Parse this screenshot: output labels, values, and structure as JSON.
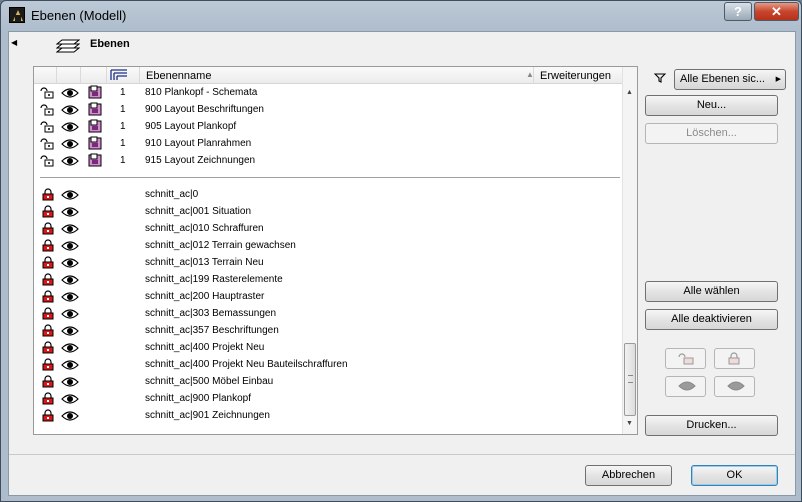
{
  "window": {
    "title": "Ebenen (Modell)",
    "help": "?",
    "close": "✕"
  },
  "header": {
    "title": "Ebenen"
  },
  "list": {
    "columns": {
      "name": "Ebenenname",
      "extensions": "Erweiterungen"
    },
    "group1": [
      {
        "num": "1",
        "name": "810 Plankopf - Schemata"
      },
      {
        "num": "1",
        "name": "900 Layout Beschriftungen"
      },
      {
        "num": "1",
        "name": "905 Layout Plankopf"
      },
      {
        "num": "1",
        "name": "910 Layout Planrahmen"
      },
      {
        "num": "1",
        "name": "915 Layout Zeichnungen"
      }
    ],
    "group2": [
      {
        "name": "schnitt_ac|0"
      },
      {
        "name": "schnitt_ac|001 Situation"
      },
      {
        "name": "schnitt_ac|010 Schraffuren"
      },
      {
        "name": "schnitt_ac|012 Terrain gewachsen"
      },
      {
        "name": "schnitt_ac|013 Terrain Neu"
      },
      {
        "name": "schnitt_ac|199 Rasterelemente"
      },
      {
        "name": "schnitt_ac|200 Hauptraster"
      },
      {
        "name": "schnitt_ac|303 Bemassungen"
      },
      {
        "name": "schnitt_ac|357 Beschriftungen"
      },
      {
        "name": "schnitt_ac|400 Projekt Neu"
      },
      {
        "name": "schnitt_ac|400 Projekt Neu Bauteilschraffuren"
      },
      {
        "name": "schnitt_ac|500 Möbel Einbau"
      },
      {
        "name": "schnitt_ac|900 Plankopf"
      },
      {
        "name": "schnitt_ac|901 Zeichnungen"
      }
    ]
  },
  "side": {
    "filter_label": "Alle Ebenen sic...",
    "new": "Neu...",
    "delete": "Löschen...",
    "select_all": "Alle wählen",
    "deactivate_all": "Alle deaktivieren",
    "print": "Drucken..."
  },
  "footer": {
    "cancel": "Abbrechen",
    "ok": "OK"
  }
}
